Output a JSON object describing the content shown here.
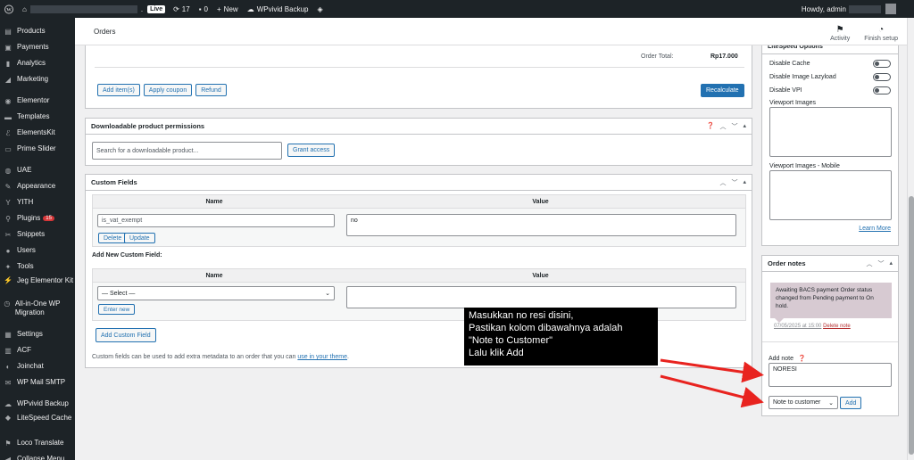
{
  "adminbar": {
    "live_label": "Live",
    "updates_count": "17",
    "comments_count": "0",
    "new_label": "New",
    "wpvivid_label": "WPvivid Backup",
    "howdy_label": "Howdy, admin"
  },
  "sidebar": {
    "items": [
      {
        "label": "Products",
        "icon": "products-icon"
      },
      {
        "label": "Payments",
        "icon": "payments-icon"
      },
      {
        "label": "Analytics",
        "icon": "analytics-icon"
      },
      {
        "label": "Marketing",
        "icon": "marketing-icon"
      },
      {
        "label": "Elementor",
        "icon": "elementor-icon"
      },
      {
        "label": "Templates",
        "icon": "templates-icon"
      },
      {
        "label": "ElementsKit",
        "icon": "elementskit-icon"
      },
      {
        "label": "Prime Slider",
        "icon": "prime-slider-icon"
      },
      {
        "label": "UAE",
        "icon": "uae-icon"
      },
      {
        "label": "Appearance",
        "icon": "appearance-icon"
      },
      {
        "label": "YITH",
        "icon": "yith-icon"
      },
      {
        "label": "Plugins",
        "icon": "plugins-icon",
        "badge": "15"
      },
      {
        "label": "Snippets",
        "icon": "snippets-icon"
      },
      {
        "label": "Users",
        "icon": "users-icon"
      },
      {
        "label": "Tools",
        "icon": "tools-icon"
      },
      {
        "label": "Jeg Elementor Kit",
        "icon": "jeg-kit-icon"
      },
      {
        "label": "All-in-One WP Migration",
        "icon": "migration-icon"
      },
      {
        "label": "Settings",
        "icon": "settings-icon"
      },
      {
        "label": "ACF",
        "icon": "acf-icon"
      },
      {
        "label": "Joinchat",
        "icon": "joinchat-icon"
      },
      {
        "label": "WP Mail SMTP",
        "icon": "mail-icon"
      },
      {
        "label": "WPvivid Backup",
        "icon": "wpvivid-icon"
      },
      {
        "label": "LiteSpeed Cache",
        "icon": "litespeed-icon"
      },
      {
        "label": "Loco Translate",
        "icon": "loco-icon"
      },
      {
        "label": "Collapse Menu",
        "icon": "collapse-icon"
      }
    ]
  },
  "header": {
    "title": "Orders",
    "activity_label": "Activity",
    "finish_setup_label": "Finish setup"
  },
  "order_items": {
    "total_label": "Order Total:",
    "total_value": "Rp17.000",
    "add_items_label": "Add item(s)",
    "apply_coupon_label": "Apply coupon",
    "refund_label": "Refund",
    "recalculate_label": "Recalculate"
  },
  "downloads": {
    "title": "Downloadable product permissions",
    "search_placeholder": "Search for a downloadable product...",
    "grant_label": "Grant access"
  },
  "custom_fields": {
    "title": "Custom Fields",
    "col_name": "Name",
    "col_value": "Value",
    "row_name": "is_vat_exempt",
    "row_value": "no",
    "delete_label": "Delete",
    "update_label": "Update",
    "add_new_heading": "Add New Custom Field:",
    "select_value": "— Select —",
    "enter_new_label": "Enter new",
    "add_custom_field_label": "Add Custom Field",
    "footer_text": "Custom fields can be used to add extra metadata to an order that you can",
    "footer_link": "use in your theme",
    "footer_end": "."
  },
  "litespeed": {
    "title": "LiteSpeed Options",
    "disable_cache": "Disable Cache",
    "disable_lazyload": "Disable Image Lazyload",
    "disable_vpi": "Disable VPI",
    "viewport_images": "Viewport Images",
    "viewport_images_mobile": "Viewport Images - Mobile",
    "learn_more": "Learn More"
  },
  "order_notes": {
    "title": "Order notes",
    "note_text": "Awaiting BACS payment Order status changed from Pending payment to On hold.",
    "note_date": "07/05/2025 at 15:00",
    "delete_note": "Delete note",
    "add_note_label": "Add note",
    "note_input_value": "NORESI",
    "note_type_value": "Note to customer",
    "add_button_label": "Add"
  },
  "annotation": {
    "line1": "Masukkan no resi disini,",
    "line2": "Pastikan kolom dibawahnya adalah",
    "line3": "\"Note to Customer\"",
    "line4": "Lalu klik Add"
  },
  "colors": {
    "admin_dark": "#1d2327",
    "wp_blue": "#2271b1",
    "note_bg": "#d7cad2",
    "arrow_red": "#e8231f"
  }
}
